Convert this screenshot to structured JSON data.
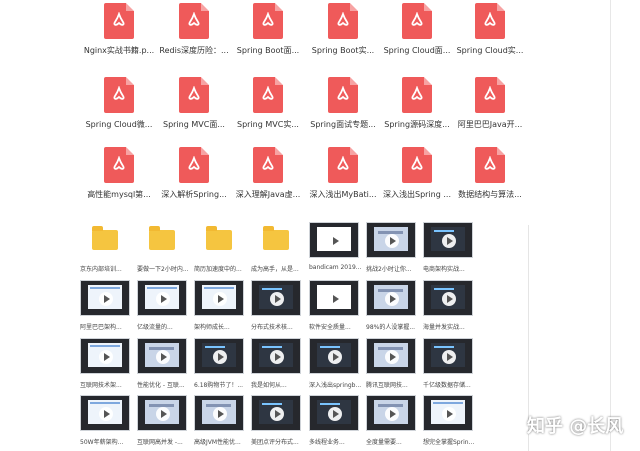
{
  "pdf_files": [
    {
      "label": "Nginx实战书籍.p..."
    },
    {
      "label": "Redis深度历险：..."
    },
    {
      "label": "Spring Boot面..."
    },
    {
      "label": "Spring Boot实..."
    },
    {
      "label": "Spring Cloud面..."
    },
    {
      "label": "Spring Cloud实..."
    },
    {
      "label": "Spring Cloud微..."
    },
    {
      "label": "Spring MVC面..."
    },
    {
      "label": "Spring MVC实..."
    },
    {
      "label": "Spring面试专题..."
    },
    {
      "label": "Spring源码深度..."
    },
    {
      "label": "阿里巴巴Java开..."
    },
    {
      "label": "高性能mysql第..."
    },
    {
      "label": "深入解析Spring..."
    },
    {
      "label": "深入理解Java虚..."
    },
    {
      "label": "深入浅出MyBati..."
    },
    {
      "label": "深入浅出Spring ..."
    },
    {
      "label": "数据结构与算法..."
    }
  ],
  "thumbnails": [
    {
      "label": "京东内部培训...",
      "kind": "folder"
    },
    {
      "label": "要做一下2小时内...",
      "kind": "folder"
    },
    {
      "label": "简历加速度中的...",
      "kind": "folder"
    },
    {
      "label": "成为高手，从是...",
      "kind": "folder"
    },
    {
      "label": "bandicam 2019...",
      "kind": "doc"
    },
    {
      "label": "挑战2小时让你...",
      "kind": "slide"
    },
    {
      "label": "电商架构实战...",
      "kind": "ide"
    },
    {
      "label": "阿里巴巴架构...",
      "kind": "browser"
    },
    {
      "label": "亿级流量的...",
      "kind": "browser"
    },
    {
      "label": "架构师成长...",
      "kind": "browser"
    },
    {
      "label": "分布式技术核...",
      "kind": "ide"
    },
    {
      "label": "软件安全质量...",
      "kind": "doc"
    },
    {
      "label": "98%的人没掌握...",
      "kind": "slide"
    },
    {
      "label": "海量并发实战...",
      "kind": "ide"
    },
    {
      "label": "互联网技术架...",
      "kind": "browser"
    },
    {
      "label": "性能优化 - 互联...",
      "kind": "slide"
    },
    {
      "label": "6.18购物节了！...",
      "kind": "ide"
    },
    {
      "label": "我是如何从...",
      "kind": "ide"
    },
    {
      "label": "深入浅出springb...",
      "kind": "ide"
    },
    {
      "label": "腾讯互联网技...",
      "kind": "slide"
    },
    {
      "label": "千亿级数据存储...",
      "kind": "ide"
    },
    {
      "label": "50W年薪架构...",
      "kind": "browser"
    },
    {
      "label": "互联网高并发 -...",
      "kind": "slide"
    },
    {
      "label": "高级JVM性能优...",
      "kind": "slide"
    },
    {
      "label": "美团点评分布式...",
      "kind": "ide"
    },
    {
      "label": "多线程业务...",
      "kind": "ide"
    },
    {
      "label": "全度量需要...",
      "kind": "slide"
    },
    {
      "label": "想完全掌握Sprin...",
      "kind": "browser"
    }
  ],
  "watermark": "知乎 @长风"
}
